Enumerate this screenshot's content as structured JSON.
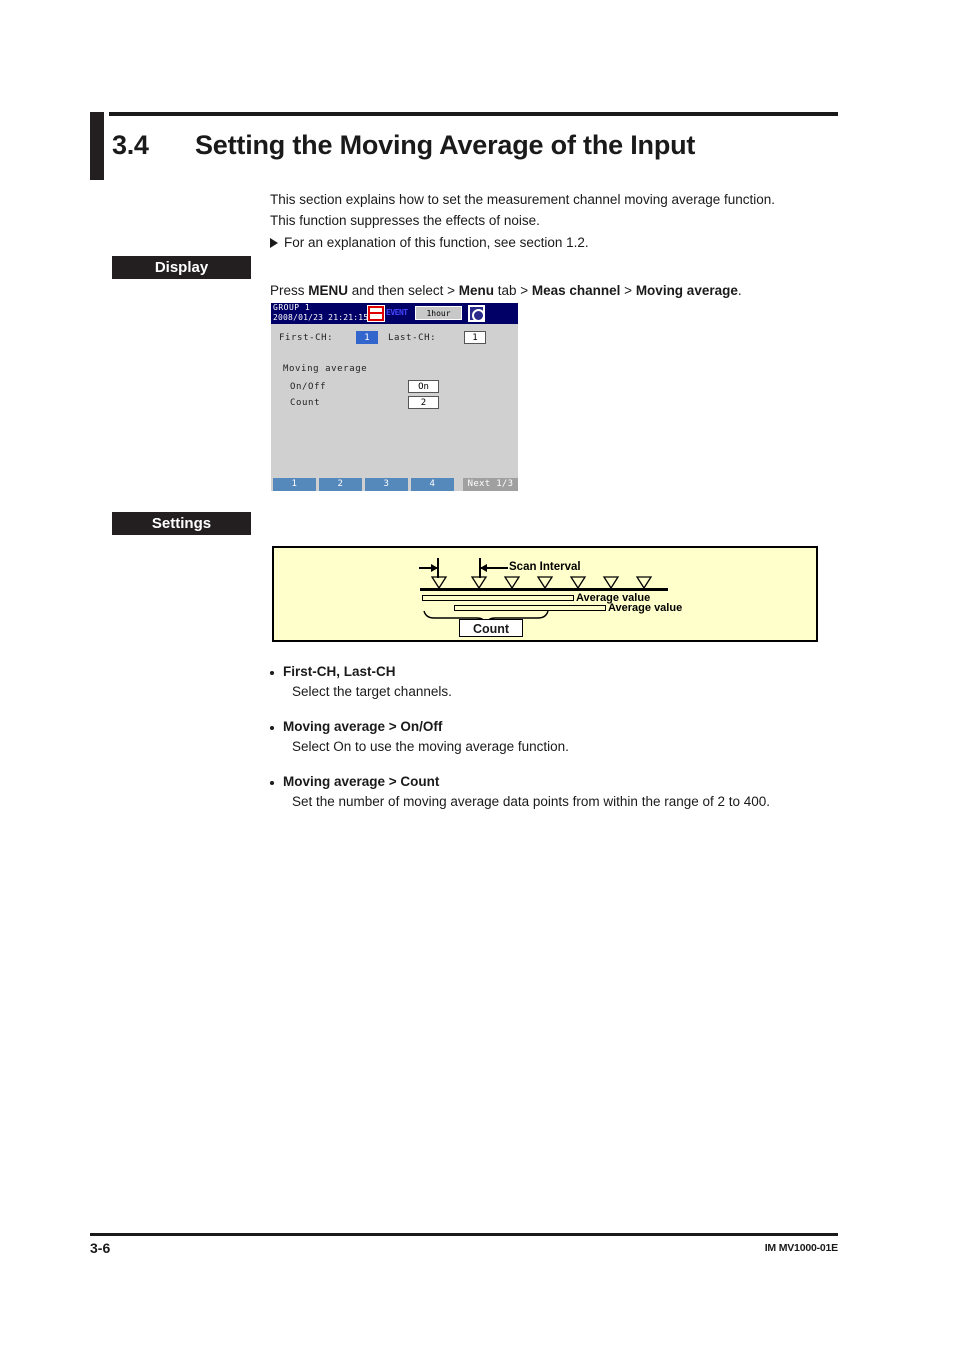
{
  "section": {
    "number": "3.4",
    "title": "Setting the Moving Average of the Input"
  },
  "intro": {
    "line1": "This section explains how to set the measurement channel moving average function.",
    "line2": "This function suppresses the effects of noise.",
    "reference": "For an explanation of this function, see section 1.2."
  },
  "badges": {
    "display": "Display",
    "settings": "Settings"
  },
  "menu_path": {
    "prefix": "Press ",
    "key": "MENU",
    "mid1": " and then select > ",
    "tab": "Menu",
    "mid2": " tab > ",
    "item1": "Meas channel",
    "mid3": " > ",
    "item2": "Moving average",
    "suffix": "."
  },
  "device": {
    "group": "GROUP 1",
    "datetime": "2008/01/23 21:21:15",
    "event_label": "EVENT",
    "interval_value": "1hour",
    "first_ch_label": "First-CH:",
    "first_ch_value": "1",
    "last_ch_label": "Last-CH:",
    "last_ch_value": "1",
    "moving_average_label": "Moving average",
    "onoff_label": "On/Off",
    "onoff_value": "On",
    "count_label": "Count",
    "count_value": "2",
    "tabs": [
      "1",
      "2",
      "3",
      "4"
    ],
    "next_label": "Next 1/3"
  },
  "diagram": {
    "scan_interval_label": "Scan Interval",
    "average_value_label_1": "Average value",
    "average_value_label_2": "Average value",
    "count_label": "Count",
    "marker_count": 7
  },
  "bullets": [
    {
      "heading": "First-CH, Last-CH",
      "body": "Select the target channels."
    },
    {
      "heading": "Moving average > On/Off",
      "body": "Select On to use the moving average function."
    },
    {
      "heading": "Moving average > Count",
      "body": "Set the number of moving average data points from within the range of 2 to 400."
    }
  ],
  "footer": {
    "page": "3-6",
    "doc_id": "IM MV1000-01E"
  },
  "colors": {
    "accent_black": "#231f20",
    "diagram_bg": "#ffffcc",
    "device_bg": "#d0d0d0",
    "device_titlebar": "#000066",
    "tab_blue": "#5588bb",
    "selected_blue": "#3366cc"
  }
}
